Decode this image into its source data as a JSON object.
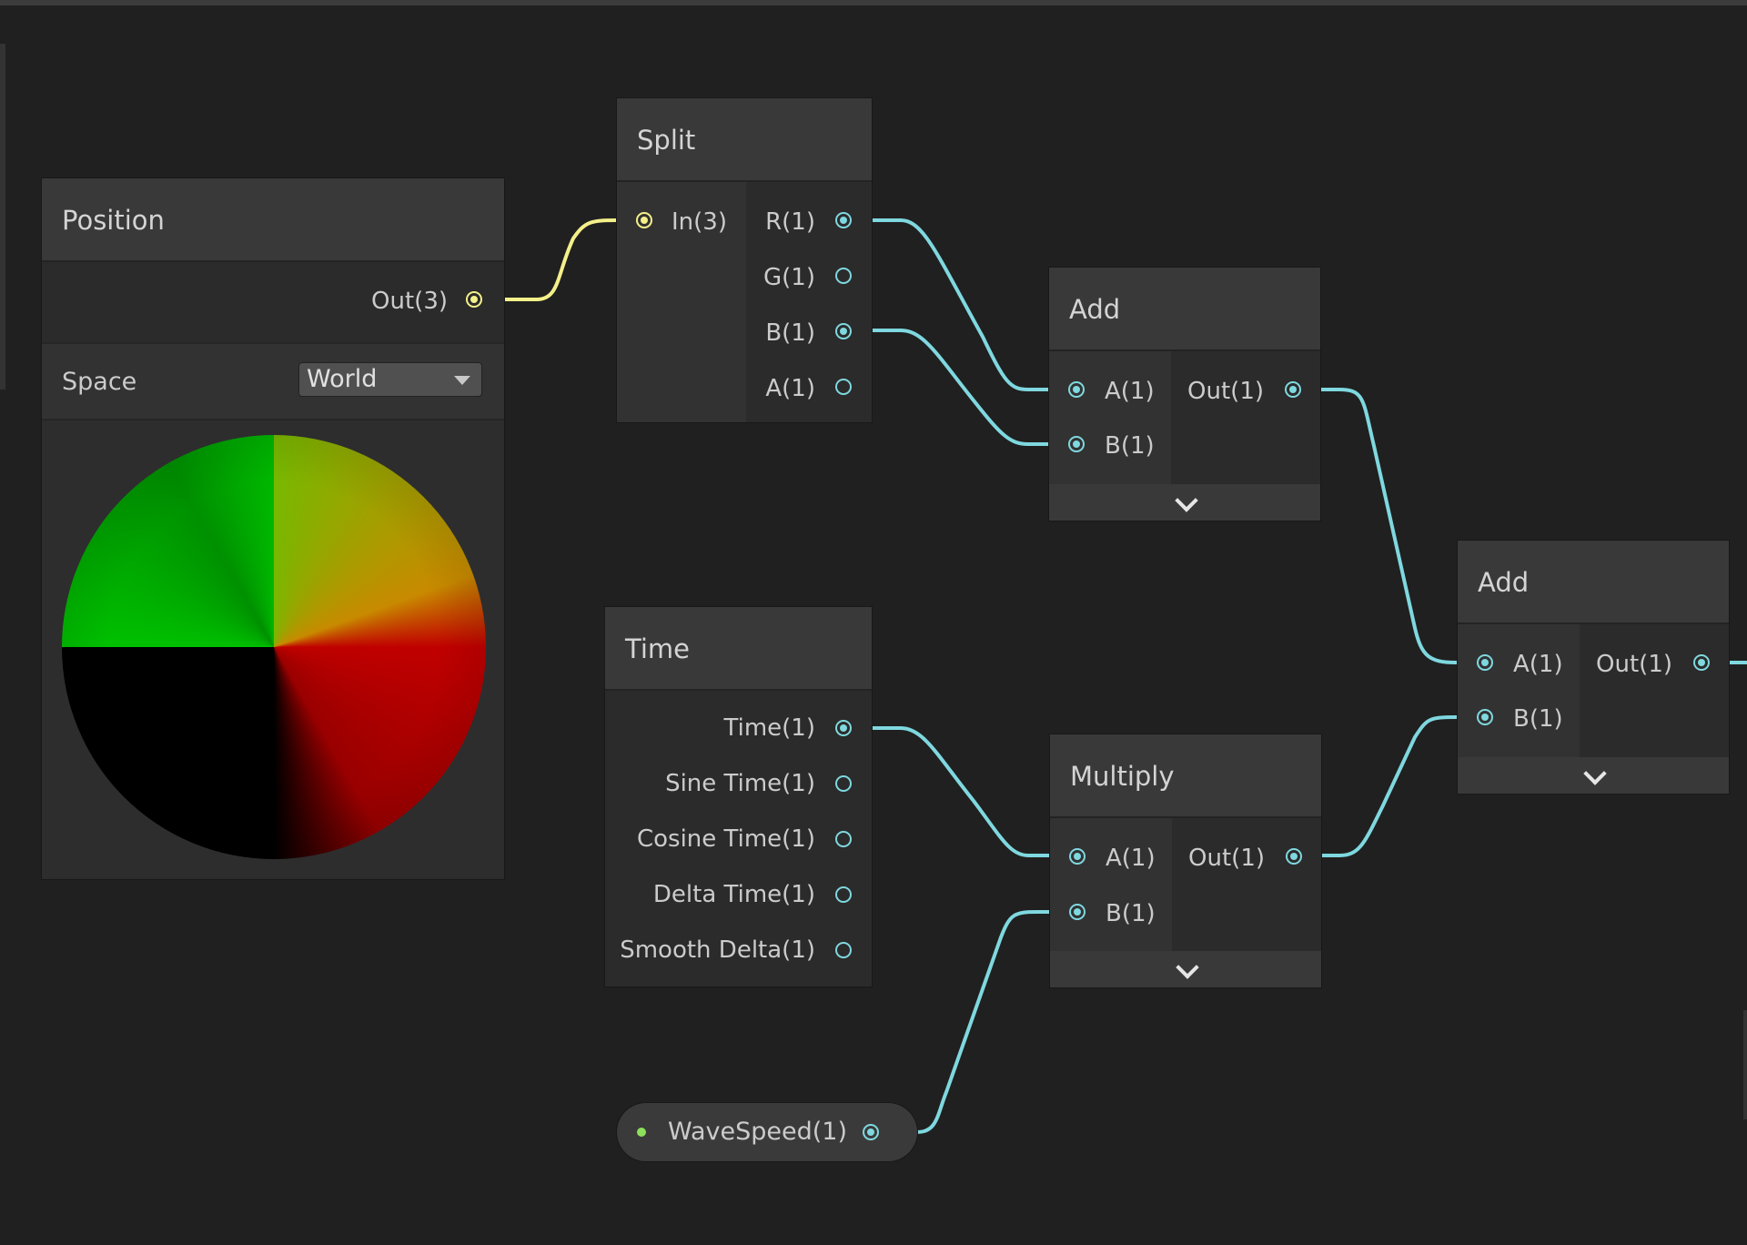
{
  "colors": {
    "background": "#202020",
    "wire_float": "#7fd8df",
    "wire_vector3": "#f4f08a",
    "property_dot": "#8de05a"
  },
  "position_node": {
    "title": "Position",
    "output": "Out(3)",
    "space_label": "Space",
    "space_value": "World"
  },
  "split_node": {
    "title": "Split",
    "input": "In(3)",
    "outputs": [
      "R(1)",
      "G(1)",
      "B(1)",
      "A(1)"
    ]
  },
  "add_node_1": {
    "title": "Add",
    "inputs": [
      "A(1)",
      "B(1)"
    ],
    "output": "Out(1)"
  },
  "add_node_2": {
    "title": "Add",
    "inputs": [
      "A(1)",
      "B(1)"
    ],
    "output": "Out(1)"
  },
  "time_node": {
    "title": "Time",
    "outputs": [
      "Time(1)",
      "Sine Time(1)",
      "Cosine Time(1)",
      "Delta Time(1)",
      "Smooth Delta(1)"
    ]
  },
  "multiply_node": {
    "title": "Multiply",
    "inputs": [
      "A(1)",
      "B(1)"
    ],
    "output": "Out(1)"
  },
  "property_node": {
    "label": "WaveSpeed(1)"
  }
}
